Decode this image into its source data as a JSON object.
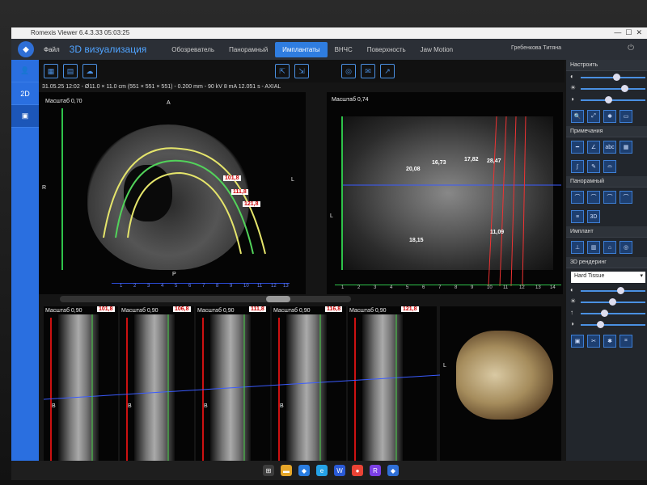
{
  "window": {
    "title": "Romexis Viewer 6.4.3.33 05:03:25"
  },
  "menu": {
    "file": "Файл",
    "app_title": "3D визуализация",
    "tabs": [
      {
        "label": "Обозреватель",
        "active": false
      },
      {
        "label": "Панорамный",
        "active": false
      },
      {
        "label": "Имплантаты",
        "active": true
      },
      {
        "label": "ВНЧС",
        "active": false
      },
      {
        "label": "Поверхность",
        "active": false
      },
      {
        "label": "Jaw Motion",
        "active": false
      }
    ],
    "user": "Гребенкова Титяна"
  },
  "leftbar": {
    "items": [
      {
        "icon": "user-icon",
        "label": ""
      },
      {
        "icon": "2d-icon",
        "label": "2D"
      },
      {
        "icon": "3d-cube-icon",
        "label": ""
      }
    ]
  },
  "info_line": "31.05.25 12:02 - Ø11.0 × 11.0 cm (551 × 551 × 551) - 0.200 mm - 90 kV 8 mA 12.051 s - AXIAL",
  "axial": {
    "scale": "Масштаб 0,70",
    "orient_top": "A",
    "orient_left": "R",
    "orient_right": "L",
    "orient_bottom": "P",
    "measurements": [
      "101,8",
      "111,8",
      "121,8"
    ],
    "ruler_ticks": [
      "1",
      "2",
      "3",
      "4",
      "5",
      "6",
      "7",
      "8",
      "9",
      "10",
      "11",
      "12",
      "13"
    ]
  },
  "panoramic": {
    "scale": "Масштаб 0,74",
    "orient_left": "L",
    "measurements": [
      "20,08",
      "16,73",
      "17,82",
      "28,47",
      "18,15",
      "11,09"
    ],
    "ruler_ticks": [
      "1",
      "2",
      "3",
      "4",
      "5",
      "6",
      "7",
      "8",
      "9",
      "10",
      "11",
      "12",
      "13",
      "14"
    ]
  },
  "cross_sections": [
    {
      "scale": "Масштаб 0,90",
      "measure": "101,8"
    },
    {
      "scale": "Масштаб 0,90",
      "measure": "106,8"
    },
    {
      "scale": "Масштаб 0,90",
      "measure": "111,8"
    },
    {
      "scale": "Масштаб 0,90",
      "measure": "116,8"
    },
    {
      "scale": "Масштаб 0,90",
      "measure": "121,8"
    }
  ],
  "cross_orient": "B",
  "render3d": {
    "orient": "L"
  },
  "right_panel": {
    "settings_header": "Настроить",
    "tools_header": "Примечания",
    "tools_text_icon": "abc",
    "pano_header": "Панорамный",
    "pano_3d_label": "3D",
    "implant_header": "Имплант",
    "render_header": "3D рендеринг",
    "render_preset": "Hard Tissue"
  },
  "colors": {
    "accent": "#2f7de0",
    "measure_text": "#cc0000",
    "ruler_blue": "#2a4bd6",
    "ruler_green": "#2ec24a"
  }
}
